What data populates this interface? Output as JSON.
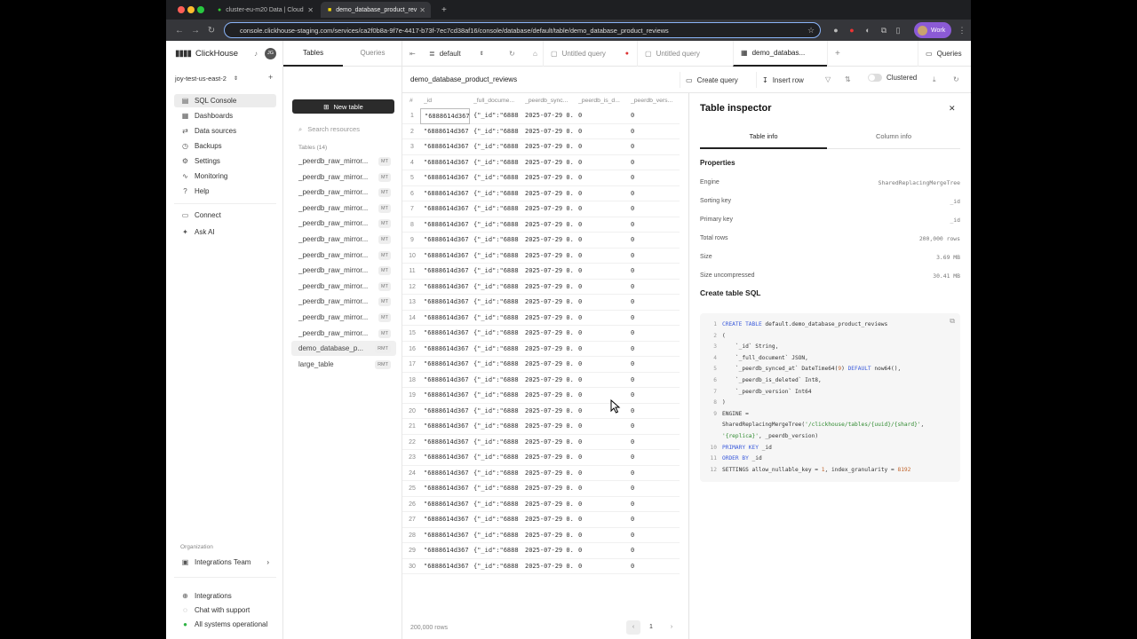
{
  "browser": {
    "tabs": [
      {
        "title": "cluster-eu-m20 Data | Cloud"
      },
      {
        "title": "demo_database_product_rev"
      }
    ],
    "url": "console.clickhouse-staging.com/services/ca2f0b8a-9f7e-4417-b73f-7ec7cd38af16/console/database/default/table/demo_database_product_reviews",
    "profile": "Work"
  },
  "sidebar": {
    "logo": "ClickHouse",
    "avatar": "JG",
    "service": "joy-test-us-east-2",
    "items": [
      {
        "label": "SQL Console",
        "icon": "console-icon"
      },
      {
        "label": "Dashboards",
        "icon": "dashboard-icon"
      },
      {
        "label": "Data sources",
        "icon": "datasource-icon"
      },
      {
        "label": "Backups",
        "icon": "backup-icon"
      },
      {
        "label": "Settings",
        "icon": "gear-icon"
      },
      {
        "label": "Monitoring",
        "icon": "monitor-icon"
      },
      {
        "label": "Help",
        "icon": "help-icon"
      }
    ],
    "connect": "Connect",
    "ask_ai": "Ask AI",
    "org_label": "Organization",
    "org_name": "Integrations Team",
    "bottom": [
      "Integrations",
      "Chat with support",
      "All systems operational"
    ]
  },
  "tables_panel": {
    "tabs": [
      "Tables",
      "Queries"
    ],
    "new_table": "New table",
    "search_placeholder": "Search resources",
    "count_label": "Tables (14)",
    "tables": [
      {
        "name": "_peerdb_raw_mirror...",
        "badge": "MT"
      },
      {
        "name": "_peerdb_raw_mirror...",
        "badge": "MT"
      },
      {
        "name": "_peerdb_raw_mirror...",
        "badge": "MT"
      },
      {
        "name": "_peerdb_raw_mirror...",
        "badge": "MT"
      },
      {
        "name": "_peerdb_raw_mirror...",
        "badge": "MT"
      },
      {
        "name": "_peerdb_raw_mirror...",
        "badge": "MT"
      },
      {
        "name": "_peerdb_raw_mirror...",
        "badge": "MT"
      },
      {
        "name": "_peerdb_raw_mirror...",
        "badge": "MT"
      },
      {
        "name": "_peerdb_raw_mirror...",
        "badge": "MT"
      },
      {
        "name": "_peerdb_raw_mirror...",
        "badge": "MT"
      },
      {
        "name": "_peerdb_raw_mirror...",
        "badge": "MT"
      },
      {
        "name": "_peerdb_raw_mirror...",
        "badge": "MT"
      },
      {
        "name": "demo_database_p...",
        "badge": "RMT"
      },
      {
        "name": "large_table",
        "badge": "RMT"
      }
    ]
  },
  "editor": {
    "db_select": "default",
    "tabs": [
      "Untitled query",
      "Untitled query",
      "demo_databas..."
    ],
    "queries_btn": "Queries",
    "table_title": "demo_database_product_reviews",
    "create_query": "Create query",
    "insert_row": "Insert row",
    "clustered": "Clustered"
  },
  "grid": {
    "columns": [
      "#",
      "_id",
      "_full_docume...",
      "_peerdb_sync...",
      "_peerdb_is_d...",
      "_peerdb_vers..."
    ],
    "cell_values": {
      "id": "\"6888614d367...",
      "doc": "{\"_id\":\"6888...",
      "synced": "2025-07-29 0...",
      "is_deleted": "0",
      "version": "0"
    },
    "row_count": 30,
    "footer_rows": "200,000 rows",
    "page": "1"
  },
  "inspector": {
    "title": "Table inspector",
    "tabs": [
      "Table info",
      "Column info"
    ],
    "properties_title": "Properties",
    "properties": [
      {
        "k": "Engine",
        "v": "SharedReplacingMergeTree"
      },
      {
        "k": "Sorting key",
        "v": "_id"
      },
      {
        "k": "Primary key",
        "v": "_id"
      },
      {
        "k": "Total rows",
        "v": "200,000 rows"
      },
      {
        "k": "Size",
        "v": "3.69 MB"
      },
      {
        "k": "Size uncompressed",
        "v": "30.41 MB"
      }
    ],
    "sql_title": "Create table SQL"
  }
}
